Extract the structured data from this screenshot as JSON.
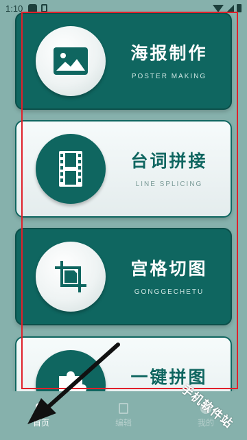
{
  "status_bar": {
    "time": "1:10"
  },
  "cards": [
    {
      "title": "海报制作",
      "subtitle": "POSTER MAKING",
      "icon": "image-icon"
    },
    {
      "title": "台词拼接",
      "subtitle": "LINE SPLICING",
      "icon": "film-icon"
    },
    {
      "title": "宫格切图",
      "subtitle": "GONGGECHETU",
      "icon": "crop-icon"
    },
    {
      "title": "一键拼图",
      "subtitle": "",
      "icon": "puzzle-icon"
    }
  ],
  "bottom_nav": {
    "items": [
      {
        "label": "首页",
        "icon": "home-icon",
        "active": true
      },
      {
        "label": "编辑",
        "icon": "edit-icon",
        "active": false
      },
      {
        "label": "我的",
        "icon": "profile-icon",
        "active": false
      }
    ]
  },
  "watermark": "手机软件站",
  "colors": {
    "accent": "#0f6660",
    "background": "#86b1ac",
    "highlight": "#e0202a"
  }
}
